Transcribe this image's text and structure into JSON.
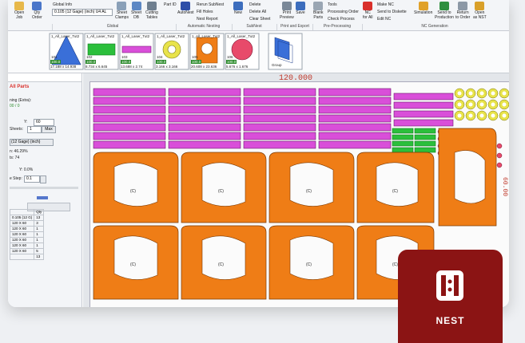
{
  "ribbon": {
    "open_job": "Open\nJob",
    "qty_order": "Qty\nOrder",
    "global_info": "Global Info",
    "material_select": "0.105 (12 Gage) (inch) U4 AL",
    "sheet_clamps": "Sheet\nClamps",
    "sheet_db": "Sheet\nDB",
    "cutting_tables": "Cutting\nTables",
    "part_id": "Part ID",
    "group_global": "Global",
    "autonest": "AutoNest",
    "rerun_subnest": "Rerun SubNest",
    "fill_holes": "Fill Holes",
    "nest_report": "Nest Report",
    "group_auto_nesting": "Automatic Nesting",
    "new": "New",
    "delete": "Delete",
    "delete_all": "Delete All",
    "clear_sheet": "Clear Sheet",
    "group_subnest": "SubNest",
    "print_preview": "Print\nPreview",
    "save": "Save",
    "group_print_export": "Print and Export",
    "blank_parts": "Blank\nParts",
    "tools": "Tools",
    "processing_order": "Processing Order",
    "check_process": "Check Process",
    "group_preprocessing": "Pre-Processing",
    "nc_for_all": "NC\nfor All",
    "make_nc": "Make NC",
    "send_to_diskette": "Send to Diskette",
    "edit_nc": "Edit NC",
    "simulation": "Simulation",
    "send_to_production": "Send to\nProduction",
    "return_to_order": "Return\nto Order",
    "open_as_nst": "Open\nas NST",
    "group_nc_generation": "NC Generation"
  },
  "parts_strip": {
    "thumbs": [
      {
        "name": "1_All_Laser_Tut2",
        "num": "101",
        "qty": "100.0",
        "dims": "17.188 x 14.938",
        "color": "#3a6fd8",
        "shape": "triangle"
      },
      {
        "name": "1_All_Laser_Tut2",
        "num": "102",
        "qty": "100.0",
        "dims": "8.734 x 6.645",
        "color": "#2bbf3b",
        "shape": "rect"
      },
      {
        "name": "1_All_Laser_Tut2",
        "num": "103",
        "qty": "100.0",
        "dims": "13.688 x 2.74",
        "color": "#d94fd9",
        "shape": "bar"
      },
      {
        "name": "1_All_Laser_Tut2",
        "num": "104",
        "qty": "100.0",
        "dims": "3.166 x 3.166",
        "color": "#e8e34a",
        "shape": "ring"
      },
      {
        "name": "1_All_Laser_Tut2",
        "num": "105",
        "qty": "100.0",
        "dims": "20.608 x 23.636",
        "color": "#ef7d16",
        "shape": "plate"
      },
      {
        "name": "1_All_Laser_Tut2",
        "num": "106",
        "qty": "100.0",
        "dims": "5.676 x 1.676",
        "color": "#e84a6a",
        "shape": "disc"
      },
      {
        "name": "Group",
        "num": "",
        "qty": "",
        "dims": "",
        "color": "#3a6fd8",
        "shape": "group"
      }
    ]
  },
  "left_panel": {
    "all_parts": "All Parts",
    "nesting_extra": "ning (Extra):",
    "nesting_val": "00 / 0",
    "y_label": "Y:",
    "y_value": "60",
    "sheets_label": "Sheets:",
    "sheets_value": "1",
    "max_button": "Max",
    "gage": "(12 Gage) (inch)",
    "util_label": "n: 46.29%",
    "parts_label": "ts: 74",
    "y_pct": "Y: 0.0%",
    "step_label": "e Step:",
    "step_value": "0.1",
    "table_header": "Qty",
    "table_rows": [
      [
        "0.105 (12 G)",
        "13"
      ],
      [
        "120 X 60",
        "3"
      ],
      [
        "120 X 60",
        "1"
      ],
      [
        "120 X 60",
        "1"
      ],
      [
        "120 X 60",
        "1"
      ],
      [
        "120 X 60",
        "1"
      ],
      [
        "120 X 60",
        "5"
      ],
      [
        "",
        "13"
      ]
    ]
  },
  "canvas": {
    "width_label": "120.000",
    "height_label": "60.00",
    "part_label": "(C)"
  },
  "badge": {
    "label": "NEST",
    "color": "#8b1414"
  }
}
